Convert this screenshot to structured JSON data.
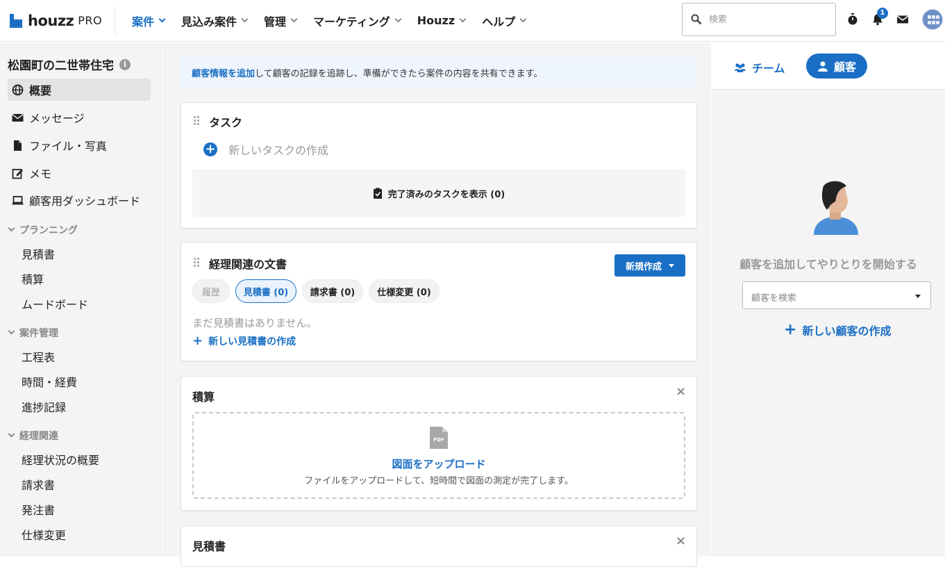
{
  "brand": {
    "name": "houzz",
    "tier": "PRO"
  },
  "nav": [
    {
      "label": "案件"
    },
    {
      "label": "見込み案件"
    },
    {
      "label": "管理"
    },
    {
      "label": "マーケティング"
    },
    {
      "label": "Houzz"
    },
    {
      "label": "ヘルプ"
    }
  ],
  "search": {
    "placeholder": "検索"
  },
  "notifications": {
    "count": "1"
  },
  "sidebar": {
    "project_title": "松園町の二世帯住宅",
    "info_glyph": "i",
    "items": [
      {
        "label": "概要"
      },
      {
        "label": "メッセージ"
      },
      {
        "label": "ファイル・写真"
      },
      {
        "label": "メモ"
      },
      {
        "label": "顧客用ダッシュボード"
      }
    ],
    "sections": [
      {
        "label": "プランニング",
        "items": [
          "見積書",
          "積算",
          "ムードボード"
        ]
      },
      {
        "label": "案件管理",
        "items": [
          "工程表",
          "時間・経費",
          "進捗記録"
        ]
      },
      {
        "label": "経理関連",
        "items": [
          "経理状況の概要",
          "請求書",
          "発注書",
          "仕様変更"
        ]
      }
    ]
  },
  "notice": {
    "link": "顧客情報を追加",
    "text": "して顧客の記録を追跡し、準備ができたら案件の内容を共有できます。"
  },
  "tasks": {
    "title": "タスク",
    "new_task": "新しいタスクの作成",
    "show_completed": "完了済みのタスクを表示 (0)"
  },
  "finance_docs": {
    "title": "経理関連の文書",
    "new_button": "新規作成",
    "tabs": [
      {
        "label": "履歴"
      },
      {
        "label": "見積書 (0)"
      },
      {
        "label": "請求書 (0)"
      },
      {
        "label": "仕様変更 (0)"
      }
    ],
    "empty": "まだ見積書はありません。",
    "create_link": "新しい見積書の作成"
  },
  "takeoff": {
    "title": "積算",
    "close": "×",
    "pdf_label": "PDF",
    "upload_title": "図面をアップロード",
    "upload_desc": "ファイルをアップロードして、短時間で図面の測定が完了します。"
  },
  "estimates": {
    "title": "見積書",
    "close": "×"
  },
  "right_panel": {
    "tab_team": "チーム",
    "tab_customer": "顧客",
    "prompt": "顧客を追加してやりとりを開始する",
    "search_placeholder": "顧客を検索",
    "new_customer": "新しい顧客の作成"
  },
  "colors": {
    "accent": "#1a6fc4",
    "sidebar_bg": "#f4f4f4",
    "muted_text": "#999999"
  }
}
